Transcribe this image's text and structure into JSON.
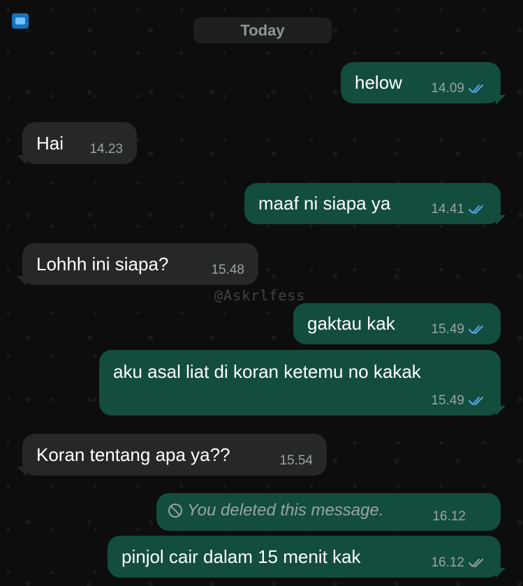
{
  "header": {
    "date_label": "Today"
  },
  "watermark": "@Askrlfess",
  "colors": {
    "outgoing_bubble": "#134d3e",
    "incoming_bubble": "#262728",
    "read_ticks": "#5aa9ee",
    "delivered_ticks": "#9aa3a6"
  },
  "messages": [
    {
      "direction": "out",
      "text": "helow",
      "time": "14.09",
      "status": "read"
    },
    {
      "direction": "in",
      "text": "Hai",
      "time": "14.23"
    },
    {
      "direction": "out",
      "text": "maaf ni siapa ya",
      "time": "14.41",
      "status": "read"
    },
    {
      "direction": "in",
      "text": "Lohhh ini siapa?",
      "time": "15.48"
    },
    {
      "direction": "out",
      "text": "gaktau kak",
      "time": "15.49",
      "status": "read"
    },
    {
      "direction": "out",
      "text": "aku asal liat di koran ketemu no kakak",
      "time": "15.49",
      "status": "read"
    },
    {
      "direction": "in",
      "text": "Koran tentang apa ya??",
      "time": "15.54"
    },
    {
      "direction": "out",
      "text": "You deleted this message.",
      "time": "16.12",
      "deleted": true
    },
    {
      "direction": "out",
      "text": "pinjol cair dalam 15 menit kak",
      "time": "16.12",
      "status": "delivered"
    }
  ]
}
